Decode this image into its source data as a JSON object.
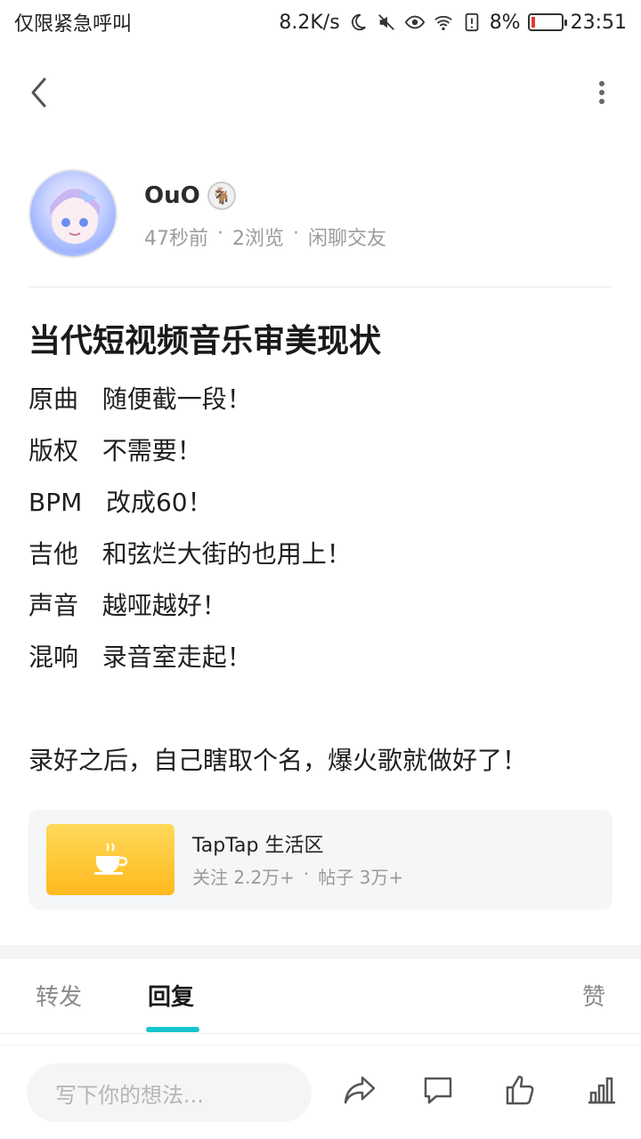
{
  "status_bar": {
    "carrier": "仅限紧急呼叫",
    "speed": "8.2K/s",
    "battery": "8%",
    "battery_level_fraction": 0.08,
    "time": "23:51"
  },
  "author": {
    "name": "OuO",
    "time_ago": "47秒前",
    "views": "2浏览",
    "category": "闲聊交友",
    "separator": "·"
  },
  "post": {
    "title": "当代短视频音乐审美现状",
    "lines": [
      "原曲   随便截一段！",
      "版权   不需要！",
      "BPM   改成60！",
      "吉他   和弦烂大街的也用上！",
      "声音   越哑越好！",
      "混响   录音室走起！"
    ],
    "closing": "录好之后，自己瞎取个名，爆火歌就做好了！"
  },
  "forum": {
    "name": "TapTap 生活区",
    "followers": "关注 2.2万+",
    "posts": "帖子 3万+",
    "separator": "·",
    "thumb_color_top": "#ffd95a",
    "thumb_color_bottom": "#ffb91e"
  },
  "tabs": {
    "repost": "转发",
    "reply": "回复",
    "like": "赞"
  },
  "bottom_bar": {
    "placeholder": "写下你的想法..."
  },
  "colors": {
    "accent": "#15c5ce",
    "battery_low": "#e53935"
  }
}
